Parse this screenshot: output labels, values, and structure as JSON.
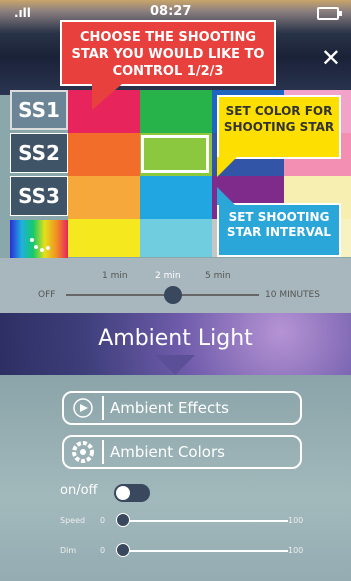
{
  "status_bar": {
    "time": "08:27"
  },
  "callouts": {
    "red": "CHOOSE THE SHOOTING STAR YOU WOULD LIKE TO CONTROL 1/2/3",
    "yellow": "SET COLOR FOR SHOOTING STAR",
    "blue": "SET SHOOTING STAR INTERVAL"
  },
  "shooting_stars": [
    {
      "label": "SS1"
    },
    {
      "label": "SS2"
    },
    {
      "label": "SS3"
    }
  ],
  "palette": {
    "row1": [
      "#e7245c",
      "#27b24a",
      "#1f66c2",
      "#f2a3c9"
    ],
    "row2": [
      "#f26c2a",
      "#8bc83f",
      "#3255a8",
      "#f28fb2"
    ],
    "row3": [
      "#f7a83a",
      "#22a6e2",
      "#7e2b8c",
      "#f6efb1"
    ],
    "row4": [
      "#f6e81f",
      "#70cde0",
      "#c6c6c6",
      "#f7f2c2"
    ]
  },
  "interval": {
    "off_label": "OFF",
    "max_label": "10 MINUTES",
    "ticks": [
      "1 min",
      "2 min",
      "5 min"
    ],
    "selected": "2 min"
  },
  "ambient": {
    "title": "Ambient Light",
    "effects_label": "Ambient Effects",
    "colors_label": "Ambient Colors",
    "onoff_label": "on/off",
    "speed": {
      "label": "Speed",
      "min": "0",
      "max": "100",
      "value": 0
    },
    "dim": {
      "label": "Dim",
      "min": "0",
      "max": "100",
      "value": 0
    }
  }
}
